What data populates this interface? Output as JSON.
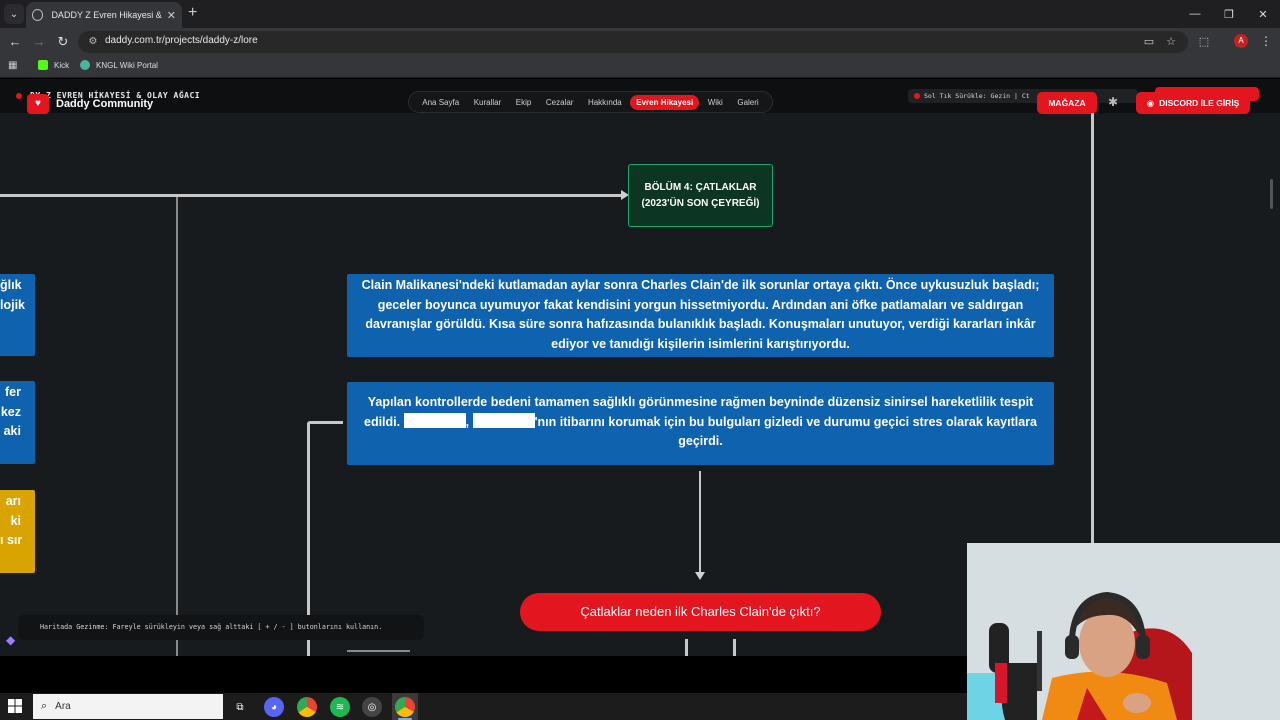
{
  "browser": {
    "tab_title": "DADDY Z Evren Hikayesi & Wh",
    "url": "daddy.com.tr/projects/daddy-z/lore",
    "profile_initial": "A",
    "bookmarks": [
      {
        "label": "Kick",
        "color": "#53fc18"
      },
      {
        "label": "KNGL Wiki Portal",
        "color": "#4ab3a0"
      }
    ]
  },
  "site": {
    "page_title": "DY Z EVREN HİKAYESİ & OLAY AĞACI",
    "logo_text": "Daddy Community",
    "logo_badge": "♥",
    "nav": [
      {
        "label": "Ana Sayfa",
        "active": false
      },
      {
        "label": "Kurallar",
        "active": false
      },
      {
        "label": "Ekip",
        "active": false
      },
      {
        "label": "Cezalar",
        "active": false
      },
      {
        "label": "Hakkında",
        "active": false
      },
      {
        "label": "Evren Hikayesi",
        "active": true
      },
      {
        "label": "Wiki",
        "active": false
      },
      {
        "label": "Galeri",
        "active": false
      }
    ],
    "hint_chip": "Sol Tık Sürükle: Gezin | Ct",
    "store_label": "MAĞAZA",
    "discord_label": "DISCORD İLE GİRİŞ",
    "accent": "#e3161f"
  },
  "flow": {
    "chapter": {
      "line1": "BÖLÜM 4: ÇATLAKLAR",
      "line2": "(2023'ÜN SON ÇEYREĞİ)"
    },
    "node1_text": "Clain Malikanesi'ndeki kutlamadan aylar sonra Charles Clain'de ilk sorunlar ortaya çıktı. Önce uykusuzluk başladı; geceler boyunca uyumuyor fakat kendisini yorgun hissetmiyordu. Ardından ani öfke patlamaları ve saldırgan davranışlar görüldü. Kısa süre sonra hafızasında bulanıklık başladı. Konuşmaları unutuyor, verdiği kararları inkâr ediyor ve tanıdığı kişilerin isimlerini karıştırıyordu.",
    "node2_before": "Yapılan kontrollerde bedeni tamamen sağlıklı görünmesine rağmen beyninde düzensiz sinirsel hareketlilik tespit edildi.",
    "node2_sep": ",",
    "node2_after": "'nın itibarını korumak için bu bulguları gizledi ve durumu geçici stres olarak kayıtlara geçirdi.",
    "side_nodes": [
      {
        "lines": [
          "ğlık",
          "lojik"
        ],
        "color": "#0f62ad"
      },
      {
        "lines": [
          "fer",
          "kez",
          "aki"
        ],
        "color": "#0f62ad"
      },
      {
        "lines": [
          "arı",
          "ki",
          "ı sır"
        ],
        "color": "#d9a400"
      }
    ],
    "question": "Çatlaklar neden ilk Charles Clain'de çıktı?",
    "toast": "Haritada Gezinme: Fareyle sürükleyin veya sağ alttaki [ + / - ] butonlarını kullanın."
  },
  "taskbar": {
    "search_placeholder": "Ara",
    "apps": [
      {
        "name": "task-view-icon",
        "color": "#1c1c1c"
      },
      {
        "name": "discord-app-icon",
        "color": "#5865f2"
      },
      {
        "name": "chrome-app-icon",
        "color": "#e8a200"
      },
      {
        "name": "spotify-app-icon",
        "color": "#1db954"
      },
      {
        "name": "obs-app-icon",
        "color": "#444444"
      },
      {
        "name": "chrome-active-app-icon",
        "color": "#e8a200"
      }
    ]
  }
}
